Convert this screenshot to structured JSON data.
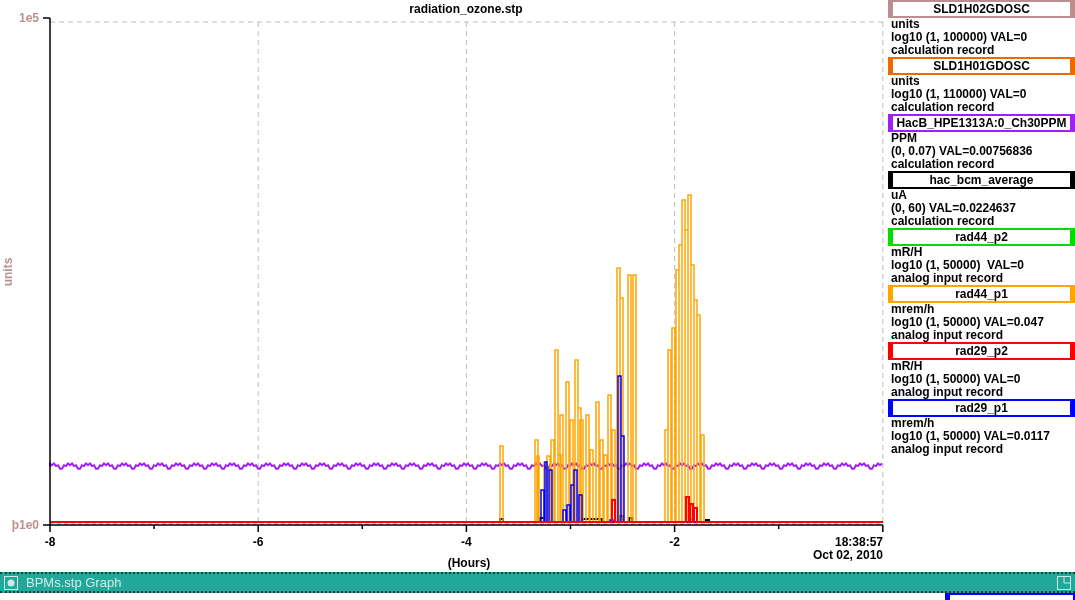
{
  "chart": {
    "title": "radiation_ozone.stp",
    "ylabel": "units",
    "yticks": [
      "1e5",
      "þ1e0"
    ],
    "xticks": [
      "-8",
      "-6",
      "-4",
      "-2"
    ],
    "time": "18:38:57",
    "date": "Oct 02, 2010",
    "xlabel": "(Hours)"
  },
  "legend": [
    {
      "name": "SLD1H02GDOSC",
      "color": "#bc8f8f",
      "units": "units",
      "range": "log10 (1, 100000) VAL=0",
      "record": "calculation record"
    },
    {
      "name": "SLD1H01GDOSC",
      "color": "#ee6a00",
      "units": "units",
      "range": "log10 (1, 110000) VAL=0",
      "record": "calculation record"
    },
    {
      "name": "HacB_HPE1313A:0_Ch30PPM",
      "color": "#a020f0",
      "units": "PPM",
      "range": "(0, 0.07) VAL=0.00756836",
      "record": "calculation record"
    },
    {
      "name": "hac_bcm_average",
      "color": "#000000",
      "units": "uA",
      "range": "(0, 60) VAL=0.0224637",
      "record": "calculation record"
    },
    {
      "name": "rad44_p2",
      "color": "#00dd00",
      "units": "mR/H",
      "range": "log10 (1, 50000)  VAL=0",
      "record": "analog input record"
    },
    {
      "name": "rad44_p1",
      "color": "#ffa500",
      "units": "mrem/h",
      "range": "log10 (1, 50000) VAL=0.047",
      "record": "analog input record"
    },
    {
      "name": "rad29_p2",
      "color": "#ff0000",
      "units": "mR/H",
      "range": "log10 (1, 50000) VAL=0",
      "record": "analog input record"
    },
    {
      "name": "rad29_p1",
      "color": "#0000ff",
      "units": "mrem/h",
      "range": "log10 (1, 50000) VAL=0.0117",
      "record": "analog input record"
    }
  ],
  "second_window": {
    "title": "BPMs.stp Graph"
  }
}
